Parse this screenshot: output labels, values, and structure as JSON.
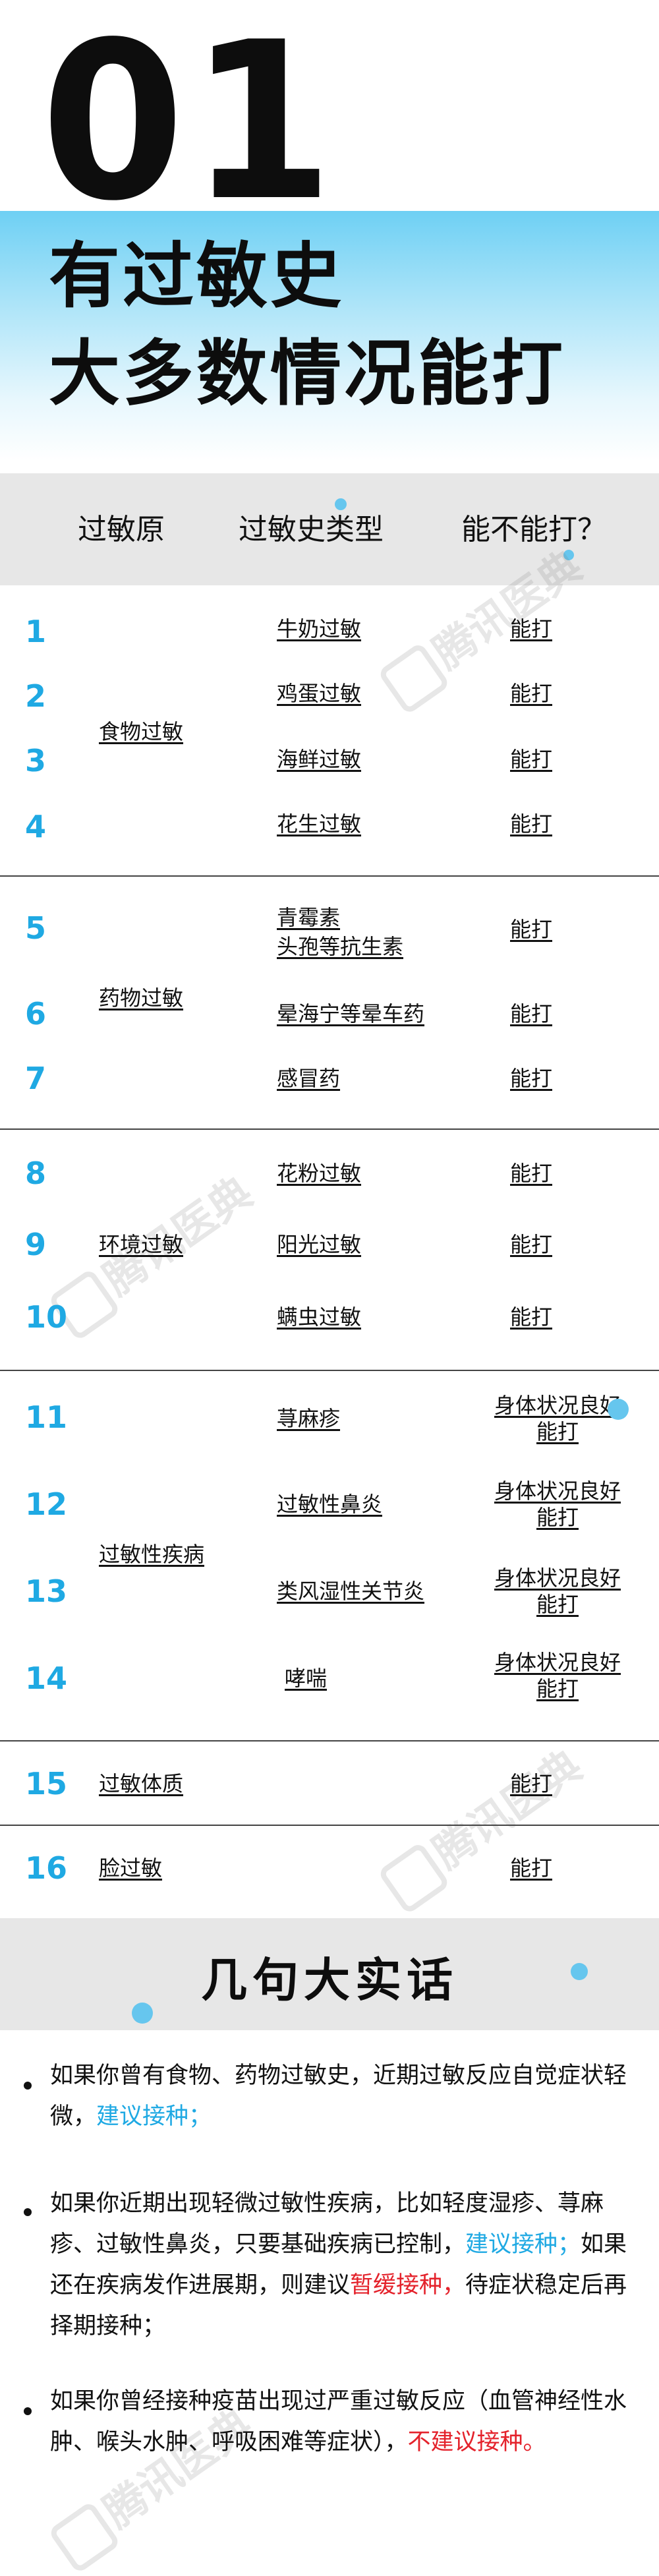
{
  "header": {
    "number": "01",
    "title_line1": "有过敏史",
    "title_line2": "大多数情况能打"
  },
  "table": {
    "headers": [
      "过敏原",
      "过敏史类型",
      "能不能打？"
    ],
    "rows": [
      {
        "num": "1",
        "type": "牛奶过敏",
        "result": "能打"
      },
      {
        "num": "2",
        "type": "鸡蛋过敏",
        "result": "能打"
      },
      {
        "num": "3",
        "type": "海鲜过敏",
        "result": "能打"
      },
      {
        "num": "4",
        "type": "花生过敏",
        "result": "能打"
      },
      {
        "num": "5",
        "type_line1": "青霉素",
        "type_line2": "头孢等抗生素",
        "result": "能打"
      },
      {
        "num": "6",
        "type": "晕海宁等晕车药",
        "result": "能打"
      },
      {
        "num": "7",
        "type": "感冒药",
        "result": "能打"
      },
      {
        "num": "8",
        "type": "花粉过敏",
        "result": "能打"
      },
      {
        "num": "9",
        "type": "阳光过敏",
        "result": "能打"
      },
      {
        "num": "10",
        "type": "螨虫过敏",
        "result": "能打"
      },
      {
        "num": "11",
        "type": "荨麻疹",
        "result_line1": "身体状况良好",
        "result_line2": "能打"
      },
      {
        "num": "12",
        "type": "过敏性鼻炎",
        "result_line1": "身体状况良好",
        "result_line2": "能打"
      },
      {
        "num": "13",
        "type": "类风湿性关节炎",
        "result_line1": "身体状况良好",
        "result_line2": "能打"
      },
      {
        "num": "14",
        "type": "哮喘",
        "result_line1": "身体状况良好",
        "result_line2": "能打"
      },
      {
        "num": "15",
        "category": "过敏体质",
        "result": "能打"
      },
      {
        "num": "16",
        "category": "脸过敏",
        "result": "能打"
      }
    ],
    "categories": {
      "food": "食物过敏",
      "drug": "药物过敏",
      "env": "环境过敏",
      "disease": "过敏性疾病"
    }
  },
  "watermark": "腾讯医典",
  "truth": {
    "title": "几句大实话",
    "p1_a": "如果你曾有食物、药物过敏史，近期过敏反应自觉症状轻微，",
    "p1_b": "建议接种；",
    "p2_a": "如果你近期出现轻微过敏性疾病，比如轻度湿疹、荨麻疹、过敏性鼻炎，只要基础疾病已控制，",
    "p2_b": "建议接种；",
    "p2_c": "如果还在疾病发作进展期，则建议",
    "p2_d": "暂缓接种，",
    "p2_e": "待症状稳定后再择期接种；",
    "p3_a": "如果你曾经接种疫苗出现过严重过敏反应（血管神经性水肿、喉头水肿、呼吸困难等症状），",
    "p3_b": "不建议接种。"
  },
  "colors": {
    "accent": "#1fa9e3",
    "warn": "#e4222b",
    "band": "#e7e7e7"
  }
}
